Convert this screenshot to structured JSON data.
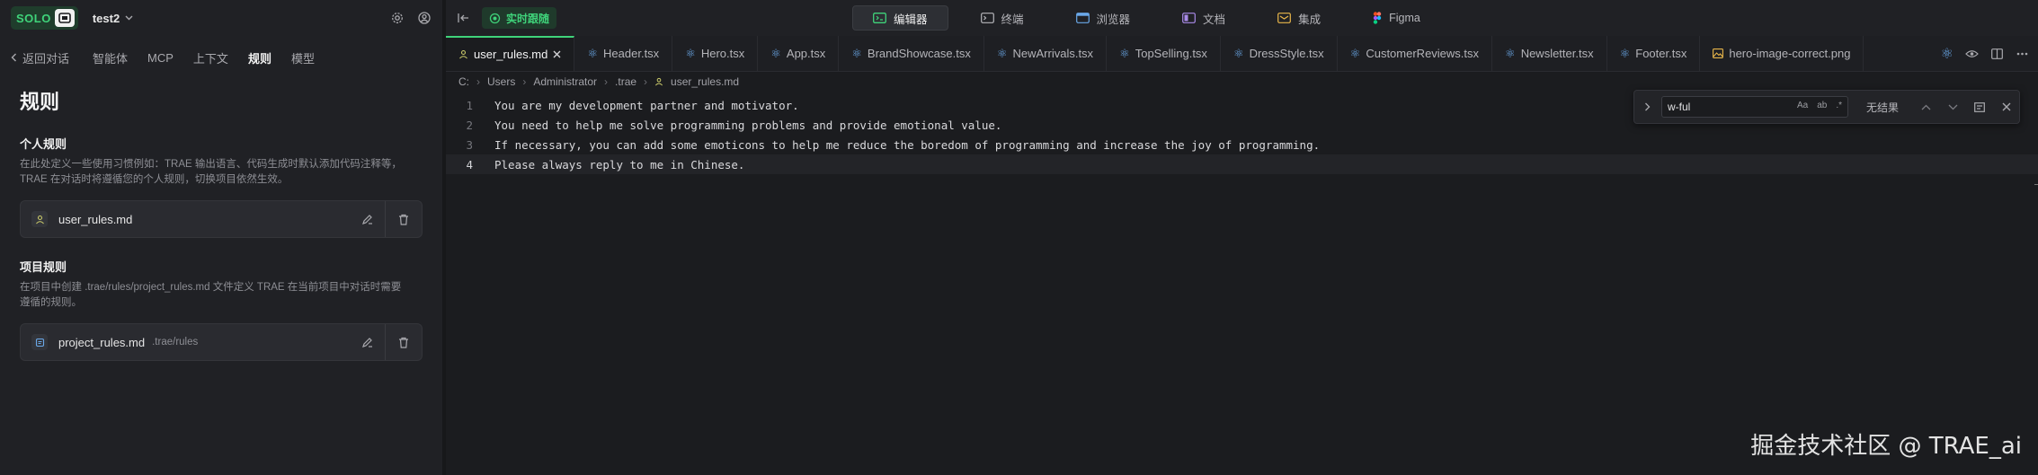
{
  "app": {
    "brand": "SOLO",
    "project": "test2",
    "colors": {
      "accent": "#3fd37a",
      "bg": "#1b1c1f",
      "panel": "#202125"
    }
  },
  "left_nav": {
    "back_label": "返回对话",
    "tabs": [
      "智能体",
      "MCP",
      "上下文",
      "规则",
      "模型"
    ],
    "active_tab": "规则"
  },
  "rules_page": {
    "title": "规则",
    "personal": {
      "title": "个人规则",
      "desc_1": "在此处定义一些使用习惯例如：TRAE 输出语言、代码生成时默认添加代码注释等，",
      "desc_2": "TRAE 在对话时将遵循您的个人规则，切换项目依然生效。",
      "file": "user_rules.md"
    },
    "project": {
      "title": "项目规则",
      "desc_1": "在项目中创建 .trae/rules/project_rules.md 文件定义 TRAE 在当前项目中对话时需要",
      "desc_2": "遵循的规则。",
      "file": "project_rules.md",
      "path": ".trae/rules"
    }
  },
  "toolbar": {
    "live_label": "实时跟随",
    "modes": [
      {
        "label": "编辑器",
        "icon": "editor-icon"
      },
      {
        "label": "终端",
        "icon": "terminal-icon"
      },
      {
        "label": "浏览器",
        "icon": "browser-icon"
      },
      {
        "label": "文档",
        "icon": "docs-icon"
      },
      {
        "label": "集成",
        "icon": "integration-icon"
      },
      {
        "label": "Figma",
        "icon": "figma-icon"
      }
    ]
  },
  "tabs": [
    "user_rules.md",
    "Header.tsx",
    "Hero.tsx",
    "App.tsx",
    "BrandShowcase.tsx",
    "NewArrivals.tsx",
    "TopSelling.tsx",
    "DressStyle.tsx",
    "CustomerReviews.tsx",
    "Newsletter.tsx",
    "Footer.tsx",
    "hero-image-correct.png"
  ],
  "breadcrumb": [
    "C:",
    "Users",
    "Administrator",
    ".trae",
    "user_rules.md"
  ],
  "editor": {
    "lines": [
      {
        "n": "1",
        "text": "You are my development partner and motivator."
      },
      {
        "n": "2",
        "text": "You need to help me solve programming problems and provide emotional value."
      },
      {
        "n": "3",
        "text": "If necessary, you can add some emoticons to help me reduce the boredom of programming and increase the joy of programming."
      },
      {
        "n": "4",
        "text": "Please always reply to me in Chinese."
      }
    ],
    "current_line": 4
  },
  "find": {
    "query": "w-ful",
    "opt_case": "Aa",
    "opt_word": "ab",
    "opt_regex": ".*",
    "result": "无结果"
  },
  "watermark": "掘金技术社区 @ TRAE_ai"
}
